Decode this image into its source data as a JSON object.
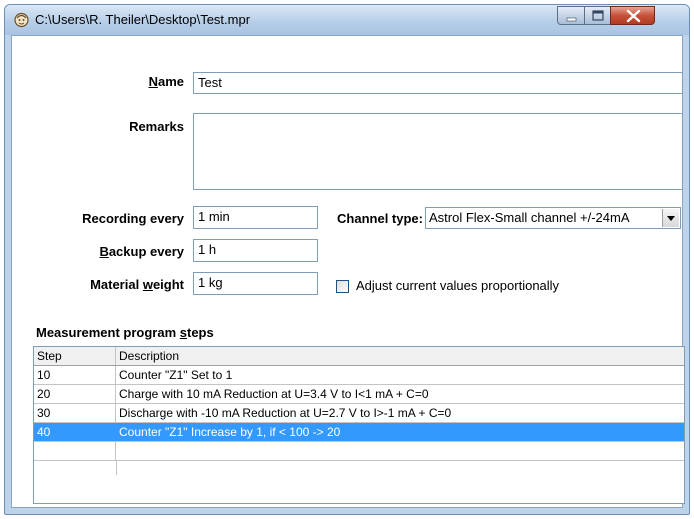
{
  "window": {
    "title": "C:\\Users\\R. Theiler\\Desktop\\Test.mpr"
  },
  "form": {
    "name_label_pre": "",
    "name_label_key": "N",
    "name_label_post": "ame",
    "name_value": "Test",
    "remarks_label": "Remarks",
    "remarks_value": "",
    "recording_label": "Recording every",
    "recording_value": "1 min",
    "channel_type_label": "Channel type:",
    "channel_type_value": "Astrol Flex-Small channel +/-24mA",
    "backup_label_key": "B",
    "backup_label_post": "ackup every",
    "backup_value": "1 h",
    "weight_label_pre": "Material ",
    "weight_label_key": "w",
    "weight_label_post": "eight",
    "weight_value": "1 kg",
    "adjust_label": "Adjust current values proportionally",
    "adjust_checked": false
  },
  "steps": {
    "section_pre": "Measurement program ",
    "section_key": "s",
    "section_post": "teps",
    "columns": [
      "Step",
      "Description"
    ],
    "rows": [
      {
        "step": "10",
        "description": "Counter \"Z1\" Set to 1"
      },
      {
        "step": "20",
        "description": "Charge with 10 mA Reduction at U=3.4 V to I<1 mA + C=0"
      },
      {
        "step": "30",
        "description": "Discharge with -10 mA Reduction at U=2.7 V to I>-1 mA + C=0"
      },
      {
        "step": "40",
        "description": "Counter \"Z1\" Increase by 1, if < 100 -> 20"
      },
      {
        "step": "",
        "description": ""
      }
    ],
    "selected_index": 3
  },
  "colors": {
    "selection": "#3399ff",
    "close_button": "#c6513a"
  }
}
